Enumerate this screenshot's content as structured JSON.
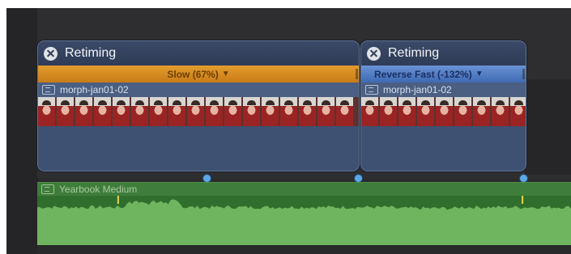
{
  "clips": [
    {
      "retiming_title": "Retiming",
      "speed_label": "Slow (67%)",
      "speed_arrow": "▼",
      "clip_name": "morph-jan01-02",
      "frame_count": 17
    },
    {
      "retiming_title": "Retiming",
      "speed_label": "Reverse Fast (-132%)",
      "speed_arrow": "▼",
      "clip_name": "morph-jan01-02",
      "frame_count": 9
    }
  ],
  "audio": {
    "clip_name": "Yearbook Medium"
  },
  "colors": {
    "slow_bar": "#d68c22",
    "fast_bar": "#5380c8",
    "clip_body": "#3b4d6b",
    "audio_body": "#2f6e2c",
    "marker": "#5ea7e6"
  }
}
